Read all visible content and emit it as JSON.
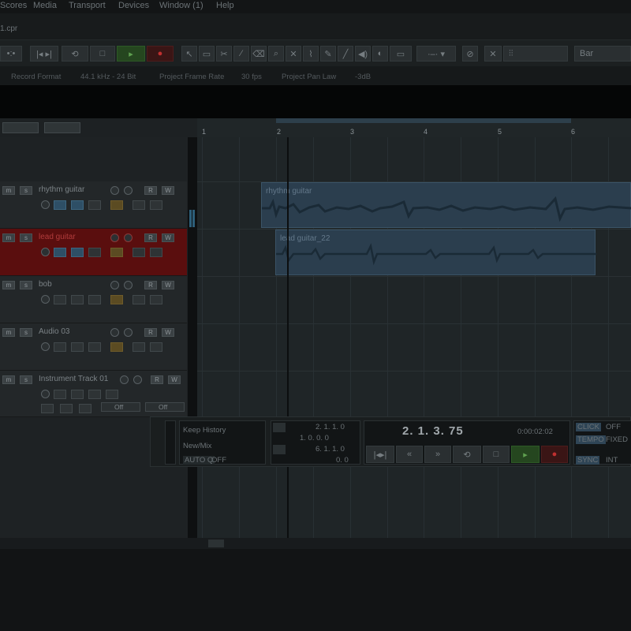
{
  "menu": [
    "Scores",
    "Media",
    "Transport",
    "Devices",
    "Window (1)",
    "Help"
  ],
  "window_title": "1.cpr",
  "toolbar": {
    "transport_buttons": [
      "go-to-start",
      "go-to-end",
      "cycle",
      "stop",
      "play",
      "record"
    ],
    "snap_label": "Bar"
  },
  "info_bar": {
    "record_format_label": "Record Format",
    "record_format_value": "44.1 kHz - 24 Bit",
    "frame_rate_label": "Project Frame Rate",
    "frame_rate_value": "30 fps",
    "pan_law_label": "Project Pan Law",
    "pan_law_value": "-3dB"
  },
  "ruler": {
    "marks": [
      "1",
      "2",
      "3",
      "4",
      "5",
      "6"
    ]
  },
  "tracks": [
    {
      "name": "rhythm guitar",
      "selected": false
    },
    {
      "name": "lead guitar",
      "selected": true
    },
    {
      "name": "bob",
      "selected": false
    },
    {
      "name": "Audio 03",
      "selected": false
    },
    {
      "name": "Instrument Track 01",
      "selected": false
    }
  ],
  "instrument_track": {
    "off1": "Off",
    "off2": "Off"
  },
  "events": [
    {
      "label": "rhythm guitar"
    },
    {
      "label": "lead guitar_22"
    }
  ],
  "transport_panel": {
    "history": "Keep History",
    "new_mix": "New/Mix",
    "auto_q": "AUTO Q",
    "auto_q_value": "OFF",
    "left_locator": "2. 1. 1.   0",
    "left_locator_2": "1. 0. 0.   0",
    "right_locator": "6. 1. 1.   0",
    "right_locator_2": "0.   0",
    "position": "2. 1. 3. 75",
    "time": "0:00:02:02",
    "click_label": "CLICK",
    "click_value": "OFF",
    "tempo_label": "TEMPO",
    "tempo_value": "FIXED",
    "sync_label": "SYNC",
    "sync_value": "INT"
  }
}
